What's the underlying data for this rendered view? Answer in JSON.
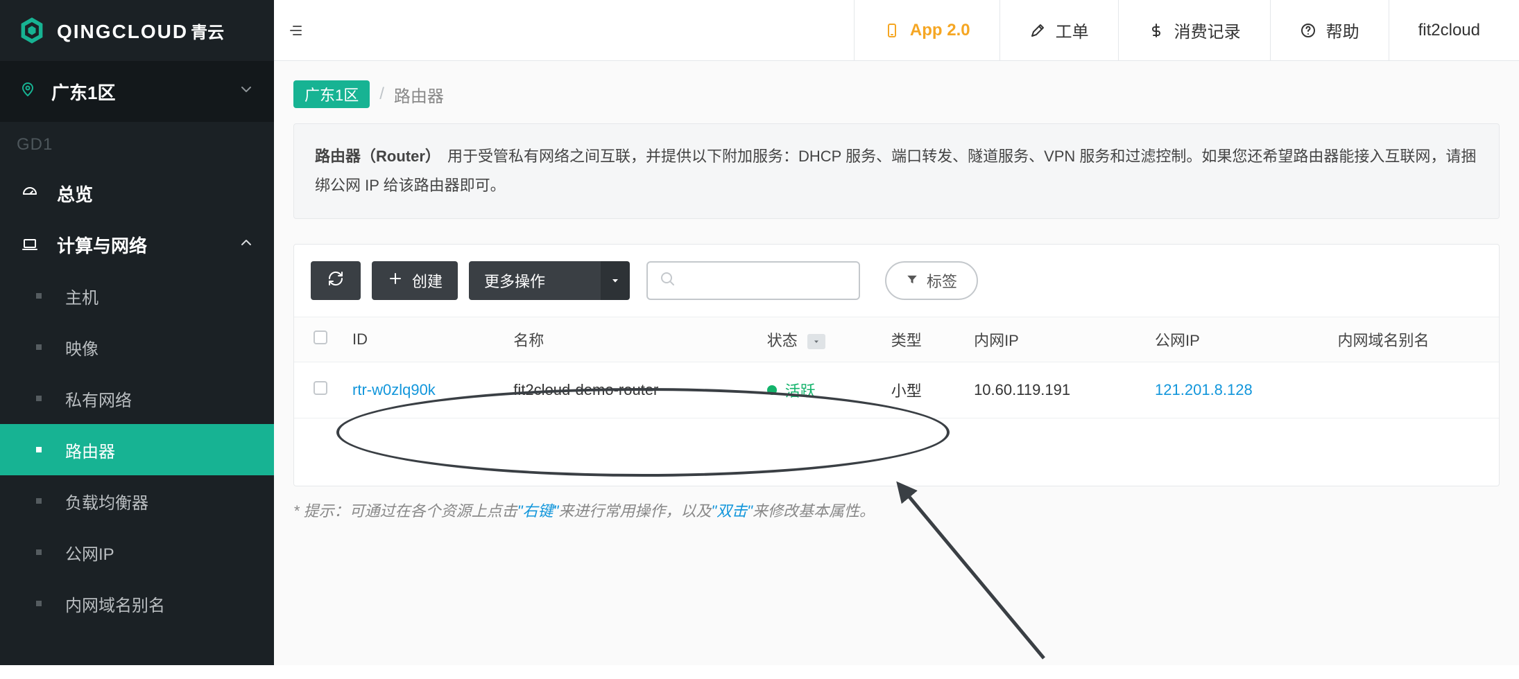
{
  "brand": {
    "name_en": "QINGCLOUD",
    "name_cn": "青云"
  },
  "region": {
    "label": "广东1区",
    "code": "GD1"
  },
  "sidebar": {
    "overview": "总览",
    "group_compute": "计算与网络",
    "items": [
      "主机",
      "映像",
      "私有网络",
      "路由器",
      "负载均衡器",
      "公网IP",
      "内网域名别名"
    ],
    "active_index": 3
  },
  "topbar": {
    "app": "App 2.0",
    "ticket": "工单",
    "billing": "消费记录",
    "help": "帮助",
    "user": "fit2cloud"
  },
  "breadcrumb": {
    "region": "广东1区",
    "current": "路由器"
  },
  "banner": {
    "title": "路由器（Router）",
    "text": "用于受管私有网络之间互联，并提供以下附加服务：DHCP 服务、端口转发、隧道服务、VPN 服务和过滤控制。如果您还希望路由器能接入互联网，请捆绑公网 IP 给该路由器即可。"
  },
  "toolbar": {
    "create": "创建",
    "more": "更多操作",
    "search_placeholder": "",
    "tag": "标签"
  },
  "table": {
    "headers": [
      "ID",
      "名称",
      "状态",
      "类型",
      "内网IP",
      "公网IP",
      "内网域名别名"
    ],
    "rows": [
      {
        "id": "rtr-w0zlq90k",
        "name": "fit2cloud-demo-router",
        "status": "活跃",
        "type": "小型",
        "private_ip": "10.60.119.191",
        "public_ip": "121.201.8.128",
        "alias": ""
      }
    ]
  },
  "hint": {
    "prefix": "* 提示：可通过在各个资源上点击",
    "q1": "\"右键\"",
    "mid": "来进行常用操作，以及",
    "q2": "\"双击\"",
    "suffix": "来修改基本属性。"
  }
}
